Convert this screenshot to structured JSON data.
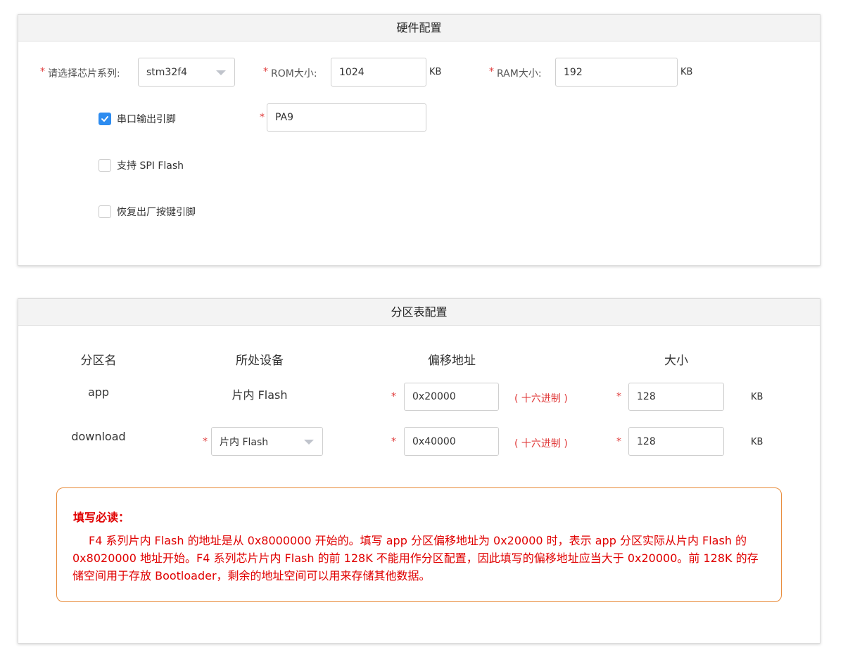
{
  "hardware": {
    "title": "硬件配置",
    "chip_series_label": "请选择芯片系列:",
    "chip_series_value": "stm32f4",
    "rom_label": "ROM大小:",
    "rom_value": "1024",
    "rom_unit": "KB",
    "ram_label": "RAM大小:",
    "ram_value": "192",
    "ram_unit": "KB",
    "serial_label": "串口输出引脚",
    "serial_checked": true,
    "serial_pin_value": "PA9",
    "spi_label": "支持 SPI Flash",
    "spi_checked": false,
    "factory_label": "恢复出厂按键引脚",
    "factory_checked": false,
    "required_mark": "*"
  },
  "partition": {
    "title": "分区表配置",
    "headers": [
      "分区名",
      "所处设备",
      "偏移地址",
      "大小"
    ],
    "rows": [
      {
        "name": "app",
        "device": "片内 Flash",
        "offset": "0x20000",
        "offset_note": "( 十六进制 )",
        "size": "128",
        "size_unit": "KB"
      },
      {
        "name": "download",
        "device": "片内 Flash",
        "offset": "0x40000",
        "offset_note": "( 十六进制 )",
        "size": "128",
        "size_unit": "KB"
      }
    ],
    "notice_title": "填写必读：",
    "notice_body": "F4 系列片内 Flash 的地址是从 0x8000000 开始的。填写 app 分区偏移地址为 0x20000 时，表示 app 分区实际从片内 Flash 的 0x8020000 地址开始。F4 系列芯片片内 Flash 的前 128K 不能用作分区配置，因此填写的偏移地址应当大于 0x20000。前 128K 的存储空间用于存放 Bootloader，剩余的地址空间可以用来存储其他数据。"
  },
  "colors": {
    "accent": "#2d8cf0",
    "required": "#e03b3b",
    "notice_text": "#e00000",
    "notice_border": "#e88b3a"
  }
}
